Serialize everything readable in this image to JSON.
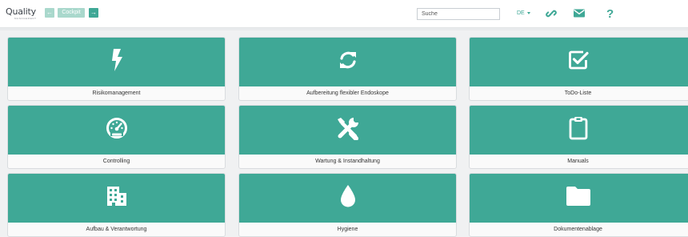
{
  "header": {
    "logo_text": "Quality",
    "logo_subtext": "MANAGEMENT",
    "back_label": "←",
    "cockpit_label": "Cockpit",
    "forward_label": "→",
    "search_placeholder": "Suche",
    "language": "DE",
    "help_label": "?",
    "icons": [
      "link-icon",
      "mail-icon",
      "help-icon"
    ]
  },
  "tiles": [
    {
      "label": "Risikomanagement",
      "icon": "lightning-icon"
    },
    {
      "label": "Aufbereitung flexibler Endoskope",
      "icon": "sync-icon"
    },
    {
      "label": "ToDo-Liste",
      "icon": "checkbox-icon"
    },
    {
      "label": "Controlling",
      "icon": "gauge-icon"
    },
    {
      "label": "Wartung & Instandhaltung",
      "icon": "tools-icon"
    },
    {
      "label": "Manuals",
      "icon": "clipboard-icon"
    },
    {
      "label": "Aufbau & Verantwortung",
      "icon": "building-icon"
    },
    {
      "label": "Hygiene",
      "icon": "drop-icon"
    },
    {
      "label": "Dokumentenablage",
      "icon": "folder-icon"
    }
  ],
  "colors": {
    "accent": "#3fa896",
    "accent_light": "#a9d8cc",
    "background": "#f0f1f2"
  }
}
